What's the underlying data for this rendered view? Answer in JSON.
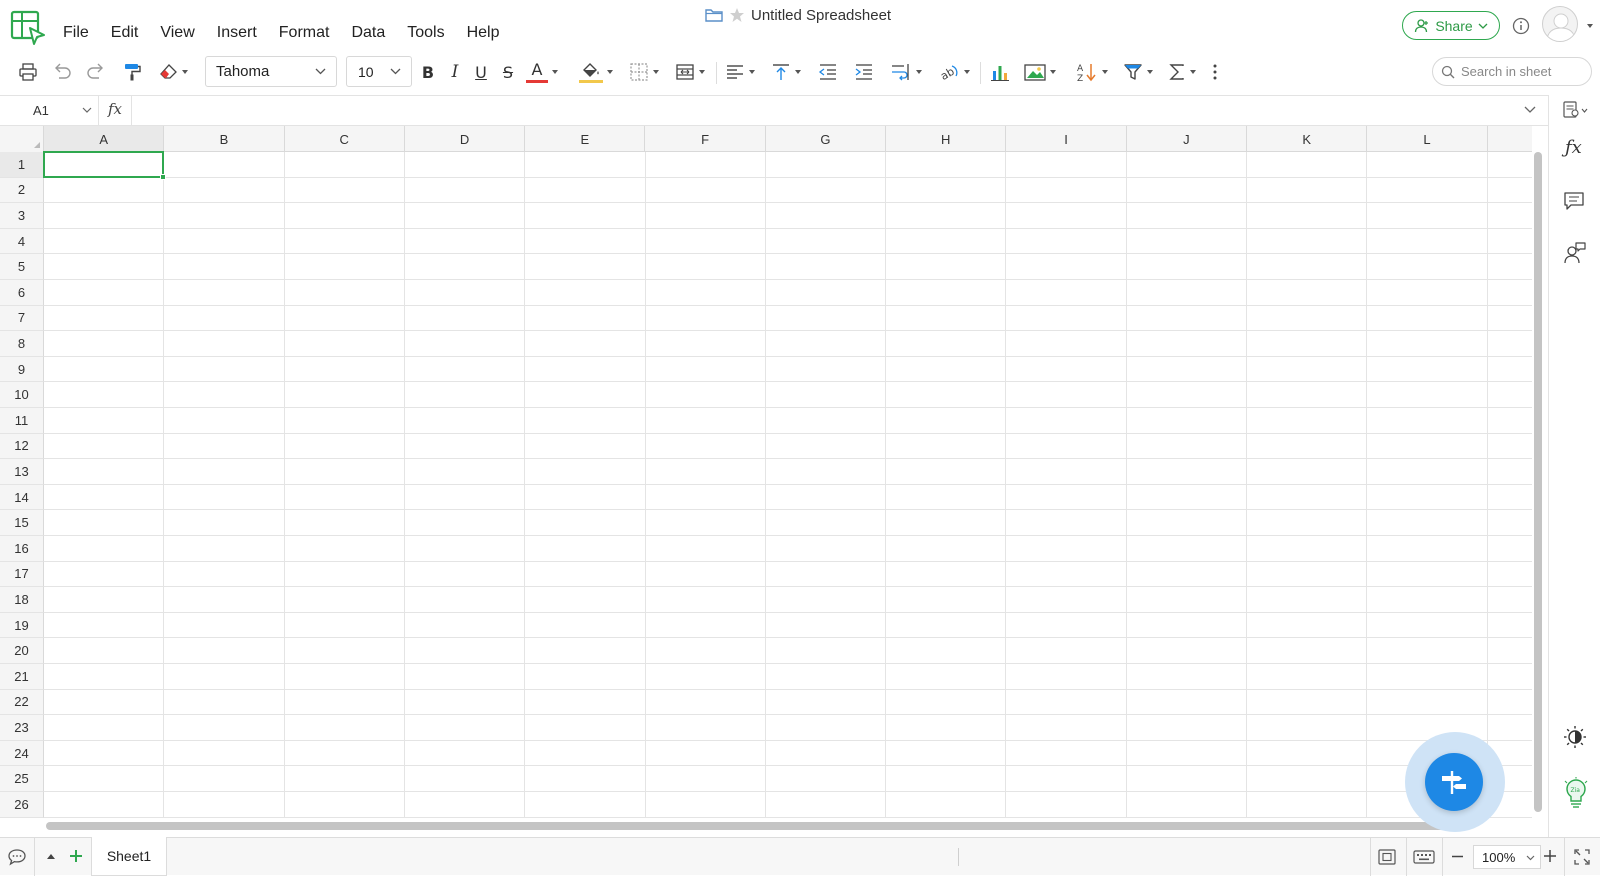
{
  "app": {
    "document_title": "Untitled Spreadsheet",
    "accent_color": "#2fa84f",
    "fab_color": "#1e88e5"
  },
  "menu": [
    "File",
    "Edit",
    "View",
    "Insert",
    "Format",
    "Data",
    "Tools",
    "Help"
  ],
  "header": {
    "share_label": "Share"
  },
  "toolbar": {
    "font_family": "Tahoma",
    "font_size": "10",
    "bold_label": "B",
    "italic_label": "I",
    "underline_label": "U",
    "strike_label": "S",
    "text_color_label": "A",
    "search_placeholder": "Search in sheet"
  },
  "formula_bar": {
    "cell_reference": "A1",
    "fx_label": "fx",
    "formula_value": ""
  },
  "grid": {
    "columns": [
      "A",
      "B",
      "C",
      "D",
      "E",
      "F",
      "G",
      "H",
      "I",
      "J",
      "K",
      "L"
    ],
    "rows": [
      "1",
      "2",
      "3",
      "4",
      "5",
      "6",
      "7",
      "8",
      "9",
      "10",
      "11",
      "12",
      "13",
      "14",
      "15",
      "16",
      "17",
      "18",
      "19",
      "20",
      "21",
      "22",
      "23",
      "24",
      "25",
      "26"
    ],
    "selected_cell": "A1"
  },
  "status_bar": {
    "sheet_tabs": [
      "Sheet1"
    ],
    "zoom": "100%"
  }
}
